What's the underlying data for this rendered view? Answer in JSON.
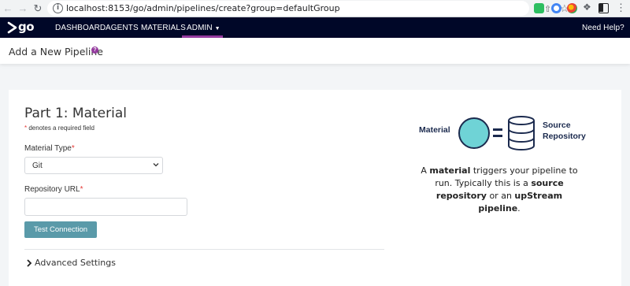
{
  "browser": {
    "url": "localhost:8153/go/admin/pipelines/create?group=defaultGroup"
  },
  "header": {
    "logo_text": "go",
    "nav": {
      "dashboard": "DASHBOARD",
      "agents": "AGENTS",
      "materials": "MATERIALS",
      "admin": "ADMIN"
    },
    "help": "Need Help?",
    "accent_color": "#943a9e",
    "background_color": "#000728"
  },
  "page": {
    "title": "Add a New Pipeline"
  },
  "form": {
    "part_title": "Part 1: Material",
    "required_note": "denotes a required field",
    "material_type_label": "Material Type",
    "material_type_value": "Git",
    "repository_url_label": "Repository URL",
    "repository_url_value": "",
    "test_button": "Test Connection",
    "test_button_color": "#5a9aa9",
    "advanced_settings": "Advanced Settings"
  },
  "illustration": {
    "material_label": "Material",
    "source_label_line1": "Source",
    "source_label_line2": "Repository",
    "circle_color": "#6fd3d6",
    "description": {
      "p1": "A ",
      "b1": "material",
      "p2": " triggers your pipeline to run. Typically this is a ",
      "b2": "source repository",
      "p3": " or an ",
      "b3": "upStream pipeline",
      "p4": "."
    }
  }
}
